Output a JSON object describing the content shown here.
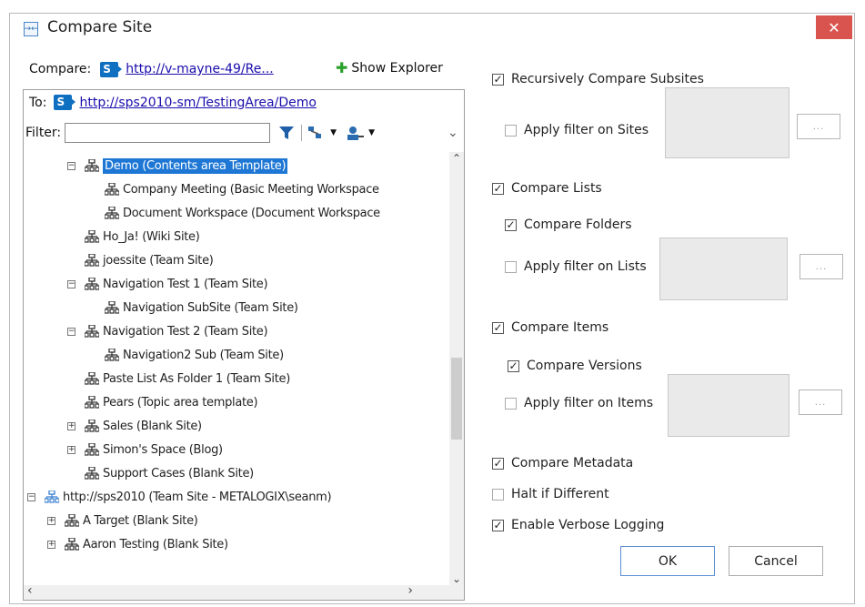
{
  "window": {
    "title": "Compare Site",
    "close_glyph": "✕",
    "app_icon": "compare-icon",
    "icon_glyph": "→←"
  },
  "compare": {
    "label": "Compare:",
    "source_url": "http://v-mayne-49/Re...",
    "show_explorer": "Show Explorer"
  },
  "target": {
    "label": "To:",
    "url": "http://sps2010-sm/TestingArea/Demo"
  },
  "filter": {
    "label": "Filter:",
    "value": ""
  },
  "tree": [
    {
      "text": "Demo (Contents area Template)",
      "expander": "⊟",
      "selected": true
    },
    {
      "text": "Company Meeting (Basic Meeting Workspace"
    },
    {
      "text": "Document Workspace (Document Workspace"
    },
    {
      "text": "Ho_Ja! (Wiki Site)"
    },
    {
      "text": "joessite (Team Site)"
    },
    {
      "text": "Navigation Test 1 (Team Site)",
      "expander": "⊟"
    },
    {
      "text": "Navigation SubSite (Team Site)"
    },
    {
      "text": "Navigation Test 2 (Team Site)",
      "expander": "⊟"
    },
    {
      "text": "Navigation2 Sub (Team Site)"
    },
    {
      "text": "Paste List As Folder 1 (Team Site)"
    },
    {
      "text": "Pears (Topic area template)"
    },
    {
      "text": "Sales (Blank Site)",
      "expander": "⊞"
    },
    {
      "text": "Simon's Space (Blog)",
      "expander": "⊞"
    },
    {
      "text": "Support Cases (Blank Site)"
    },
    {
      "text": "http://sps2010 (Team Site - METALOGIX\\seanm)",
      "expander": "⊟"
    },
    {
      "text": "A Target (Blank Site)",
      "expander": "⊞"
    },
    {
      "text": "Aaron Testing (Blank Site)",
      "expander": "⊞"
    }
  ],
  "options": {
    "recursive": {
      "label": "Recursively Compare Subsites",
      "checked": true
    },
    "filter_sites": {
      "label": "Apply filter on Sites",
      "checked": false
    },
    "compare_lists": {
      "label": "Compare Lists",
      "checked": true
    },
    "compare_folders": {
      "label": "Compare Folders",
      "checked": true
    },
    "filter_lists": {
      "label": "Apply filter on Lists",
      "checked": false
    },
    "compare_items": {
      "label": "Compare Items",
      "checked": true
    },
    "compare_versions": {
      "label": "Compare Versions",
      "checked": true
    },
    "filter_items": {
      "label": "Apply filter on Items",
      "checked": false
    },
    "compare_metadata": {
      "label": "Compare Metadata",
      "checked": true
    },
    "halt": {
      "label": "Halt if Different",
      "checked": false
    },
    "verbose": {
      "label": "Enable Verbose Logging",
      "checked": true
    }
  },
  "dots_label": "...",
  "buttons": {
    "ok": "OK",
    "cancel": "Cancel"
  },
  "colors": {
    "selection": "#1e77d4",
    "close": "#d9534f",
    "link": "#1a0dab"
  }
}
